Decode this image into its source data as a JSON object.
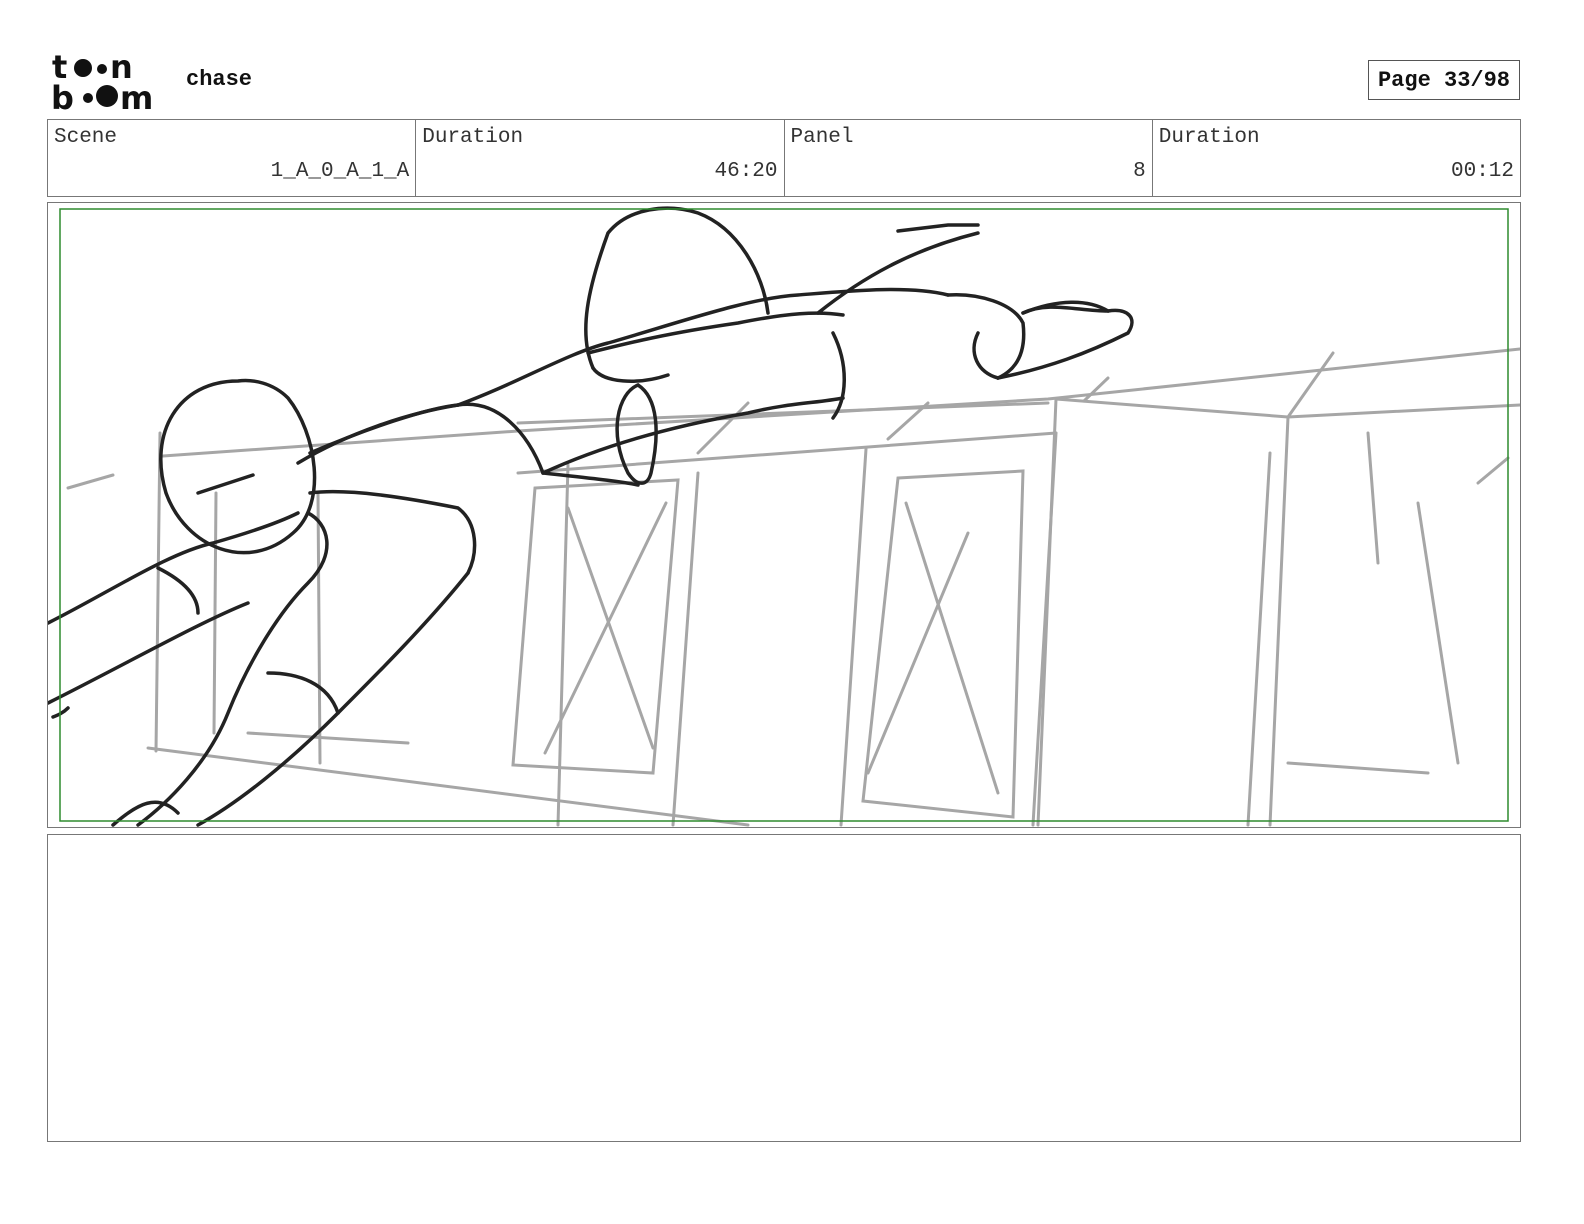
{
  "header": {
    "logo_text": "toonboom",
    "project_title": "chase",
    "page_label": "Page",
    "page_number": "33/98"
  },
  "info": {
    "scene_label": "Scene",
    "scene_value": "1_A_0_A_1_A",
    "scene_duration_label": "Duration",
    "scene_duration_value": "46:20",
    "panel_label": "Panel",
    "panel_value": "8",
    "panel_duration_label": "Duration",
    "panel_duration_value": "00:12"
  },
  "colors": {
    "safe_frame": "#2e8b2e",
    "sketch_dark": "#1e1e1e",
    "sketch_light": "#9a9a9a"
  },
  "notes": {
    "text": ""
  }
}
